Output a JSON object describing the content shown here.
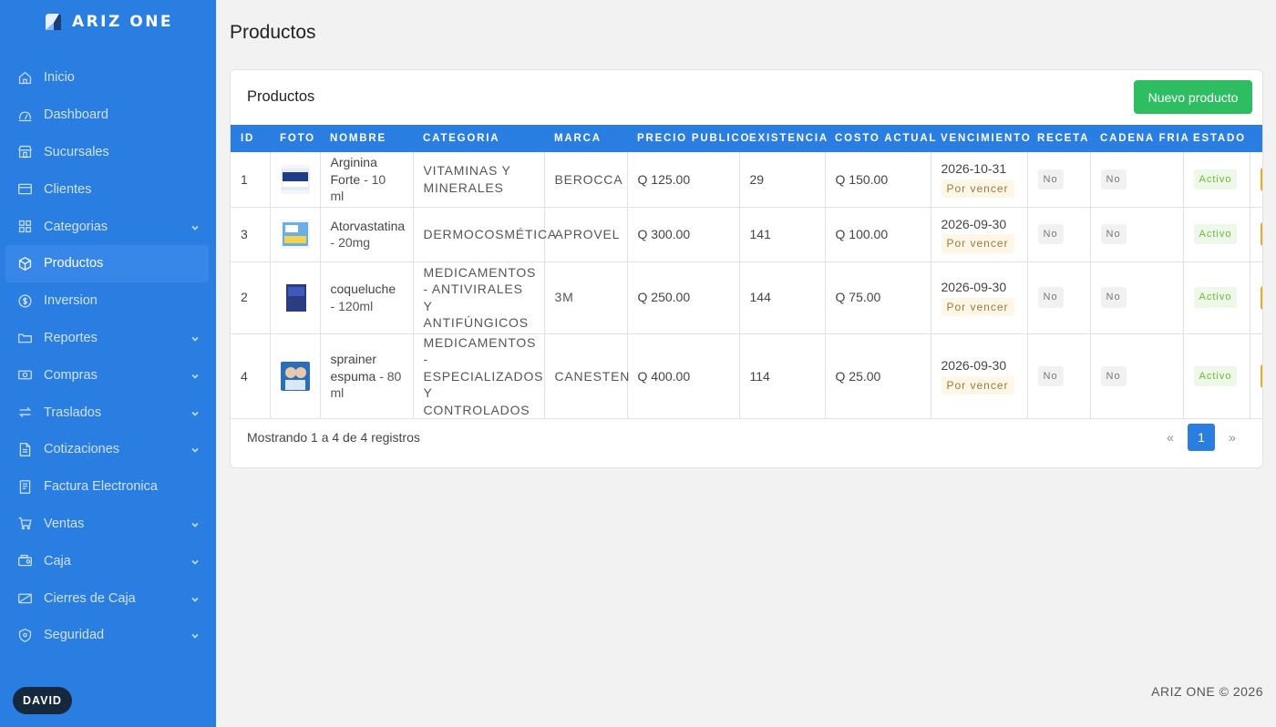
{
  "brand": {
    "name": "ARIZ ONE",
    "logo_icon": "ariz-logo-icon"
  },
  "sidebar": {
    "items": [
      {
        "label": "Inicio",
        "icon": "home-icon",
        "has_submenu": false
      },
      {
        "label": "Dashboard",
        "icon": "dashboard-icon",
        "has_submenu": false
      },
      {
        "label": "Sucursales",
        "icon": "store-icon",
        "has_submenu": false
      },
      {
        "label": "Clientes",
        "icon": "clients-icon",
        "has_submenu": false
      },
      {
        "label": "Categorias",
        "icon": "grid-icon",
        "has_submenu": true
      },
      {
        "label": "Productos",
        "icon": "box-icon",
        "has_submenu": false,
        "active": true
      },
      {
        "label": "Inversion",
        "icon": "coin-icon",
        "has_submenu": false
      },
      {
        "label": "Reportes",
        "icon": "report-icon",
        "has_submenu": true
      },
      {
        "label": "Compras",
        "icon": "cash-icon",
        "has_submenu": true
      },
      {
        "label": "Traslados",
        "icon": "transfer-icon",
        "has_submenu": true
      },
      {
        "label": "Cotizaciones",
        "icon": "document-icon",
        "has_submenu": true
      },
      {
        "label": "Factura Electronica",
        "icon": "invoice-icon",
        "has_submenu": false
      },
      {
        "label": "Ventas",
        "icon": "cart-icon",
        "has_submenu": true
      },
      {
        "label": "Caja",
        "icon": "register-icon",
        "has_submenu": true
      },
      {
        "label": "Cierres de Caja",
        "icon": "register-closed-icon",
        "has_submenu": true
      },
      {
        "label": "Seguridad",
        "icon": "shield-icon",
        "has_submenu": true
      }
    ],
    "user": "DAVID"
  },
  "page": {
    "title": "Productos"
  },
  "card": {
    "title": "Productos",
    "new_button": "Nuevo producto",
    "columns": [
      "ID",
      "FOTO",
      "NOMBRE",
      "CATEGORIA",
      "MARCA",
      "PRECIO PUBLICO",
      "EXISTENCIA",
      "COSTO ACTUAL",
      "VENCIMIENTO",
      "RECETA",
      "CADENA FRIA",
      "ESTADO"
    ],
    "rows": [
      {
        "id": "1",
        "photo": "arginina-forte-thumb",
        "name": "Arginina Forte",
        "size": "10 ml",
        "category": "VITAMINAS Y MINERALES",
        "brand": "BEROCCA",
        "price": "Q 125.00",
        "stock": "29",
        "cost": "Q 150.00",
        "expiry": "2026-10-31",
        "expiry_status": "Por vencer",
        "prescription": "No",
        "cold_chain": "No",
        "status": "Activo"
      },
      {
        "id": "3",
        "photo": "atorvastatina-thumb",
        "name": "Atorvastatina",
        "size": "20mg",
        "category": "DERMOCOSMÉTICA",
        "brand": "APROVEL",
        "price": "Q 300.00",
        "stock": "141",
        "cost": "Q 100.00",
        "expiry": "2026-09-30",
        "expiry_status": "Por vencer",
        "prescription": "No",
        "cold_chain": "No",
        "status": "Activo"
      },
      {
        "id": "2",
        "photo": "coqueluche-thumb",
        "name": "coqueluche",
        "size": "120ml",
        "category": "MEDICAMENTOS - ANTIVIRALES Y ANTIFÚNGICOS",
        "brand": "3M",
        "price": "Q 250.00",
        "stock": "144",
        "cost": "Q 75.00",
        "expiry": "2026-09-30",
        "expiry_status": "Por vencer",
        "prescription": "No",
        "cold_chain": "No",
        "status": "Activo"
      },
      {
        "id": "4",
        "photo": "sprainer-espuma-thumb",
        "name": "sprainer espuma",
        "size": "80 ml",
        "category": "MEDICAMENTOS - ESPECIALIZADOS Y CONTROLADOS",
        "brand": "CANESTEN",
        "price": "Q 400.00",
        "stock": "114",
        "cost": "Q 25.00",
        "expiry": "2026-09-30",
        "expiry_status": "Por vencer",
        "prescription": "No",
        "cold_chain": "No",
        "status": "Activo"
      }
    ],
    "footer_info": "Mostrando 1 a 4 de 4 registros",
    "pagination": {
      "prev": "«",
      "current": "1",
      "next": "»"
    }
  },
  "copyright": "ARIZ ONE © 2026",
  "colors": {
    "primary": "#2a7de1",
    "success": "#2fbd61",
    "warning": "#f5a623"
  }
}
